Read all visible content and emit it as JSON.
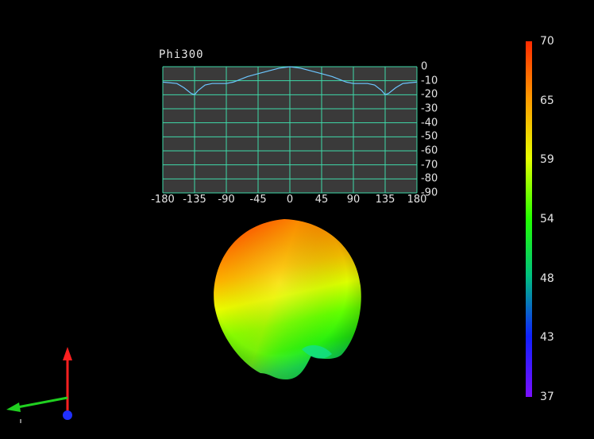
{
  "plot": {
    "title": "Phi300",
    "x_ticks": [
      "-180",
      "-135",
      "-90",
      "-45",
      "0",
      "45",
      "90",
      "135",
      "180"
    ],
    "y_ticks": [
      "0",
      "-10",
      "-20",
      "-30",
      "-40",
      "-50",
      "-60",
      "-70",
      "-80",
      "-90"
    ],
    "grid_color": "#3fd9a8",
    "curve_color": "#6cc6ff"
  },
  "chart_data": {
    "type": "line",
    "title": "Phi300",
    "xlim": [
      -180,
      180
    ],
    "ylim": [
      -90,
      0
    ],
    "x": [
      -180,
      -160,
      -150,
      -140,
      -135,
      -130,
      -120,
      -110,
      -100,
      -90,
      -80,
      -70,
      -60,
      -45,
      -30,
      -15,
      0,
      15,
      30,
      45,
      60,
      70,
      80,
      90,
      100,
      110,
      120,
      130,
      135,
      140,
      150,
      160,
      180
    ],
    "y": [
      -11,
      -12,
      -15,
      -19,
      -20,
      -17,
      -13,
      -12,
      -12,
      -12,
      -11,
      -9,
      -7,
      -5,
      -3,
      -1,
      0,
      -1,
      -3,
      -5,
      -7,
      -9,
      -11,
      -12,
      -12,
      -12,
      -13,
      -17,
      -20,
      -19,
      -15,
      -12,
      -11
    ],
    "grid": true
  },
  "colorbar": {
    "labels": [
      "70",
      "65",
      "59",
      "54",
      "48",
      "43",
      "37"
    ],
    "colors": [
      "#ff2a00",
      "#ff9a00",
      "#e6ff00",
      "#22ff00",
      "#00c080",
      "#1020ff",
      "#7a10ff"
    ]
  },
  "triad": {
    "z_color": "#ff2020",
    "x_color": "#20d020",
    "y_color": "#2030ff"
  }
}
